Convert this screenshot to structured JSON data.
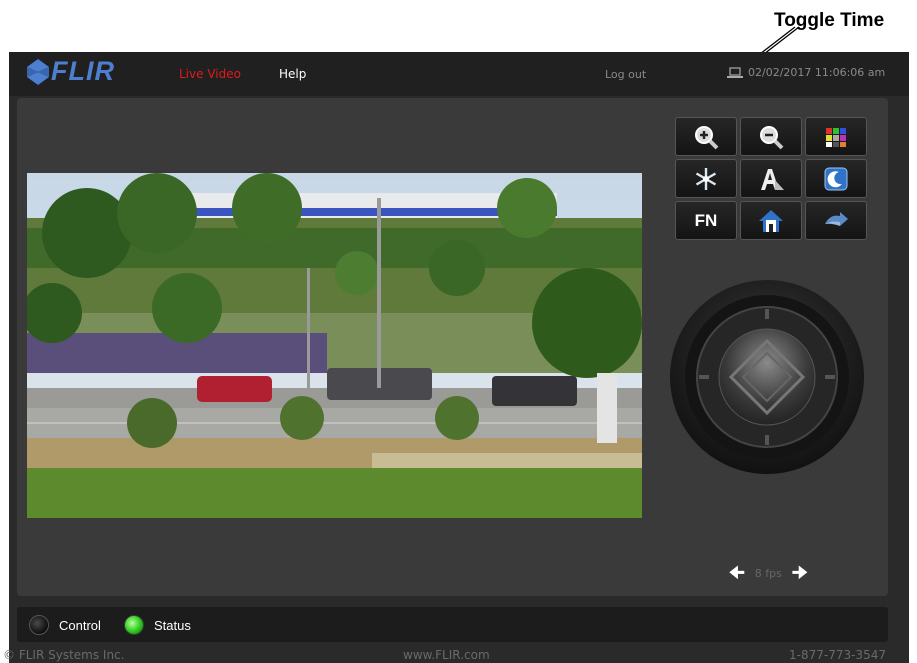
{
  "annotation": {
    "label": "Toggle Time"
  },
  "header": {
    "logo": "FLIR",
    "nav": [
      {
        "label": "Live Video",
        "color": "#e01b1b",
        "active": true
      },
      {
        "label": "Help",
        "color": "#ffffff",
        "active": false
      }
    ],
    "logout_label": "Log out",
    "datetime": "02/02/2017 11:06:06 am",
    "time_icon": "laptop-icon"
  },
  "controls": {
    "buttons": [
      {
        "icon": "zoom-in-icon"
      },
      {
        "icon": "zoom-out-icon"
      },
      {
        "icon": "color-palette-icon"
      },
      {
        "icon": "snowflake-icon"
      },
      {
        "icon": "auto-focus-icon"
      },
      {
        "icon": "night-mode-icon"
      },
      {
        "label": "FN",
        "icon": "function-icon"
      },
      {
        "icon": "home-icon"
      },
      {
        "icon": "swap-camera-icon"
      }
    ],
    "joystick_icon": "ptz-joystick-icon"
  },
  "video": {
    "content": "live-camera-feed"
  },
  "fps": {
    "label": "8 fps"
  },
  "status": {
    "control_label": "Control",
    "status_label": "Status",
    "colors": {
      "control_led": "#1a1a1a",
      "status_led": "#29c91c"
    }
  },
  "footer": {
    "copyright": "© FLIR Systems Inc.",
    "website": "www.FLIR.com",
    "phone": "1-877-773-3547"
  },
  "colors": {
    "accent": "#e01b1b",
    "brand": "#4d7fd0",
    "panel": "#3a3a3a"
  }
}
